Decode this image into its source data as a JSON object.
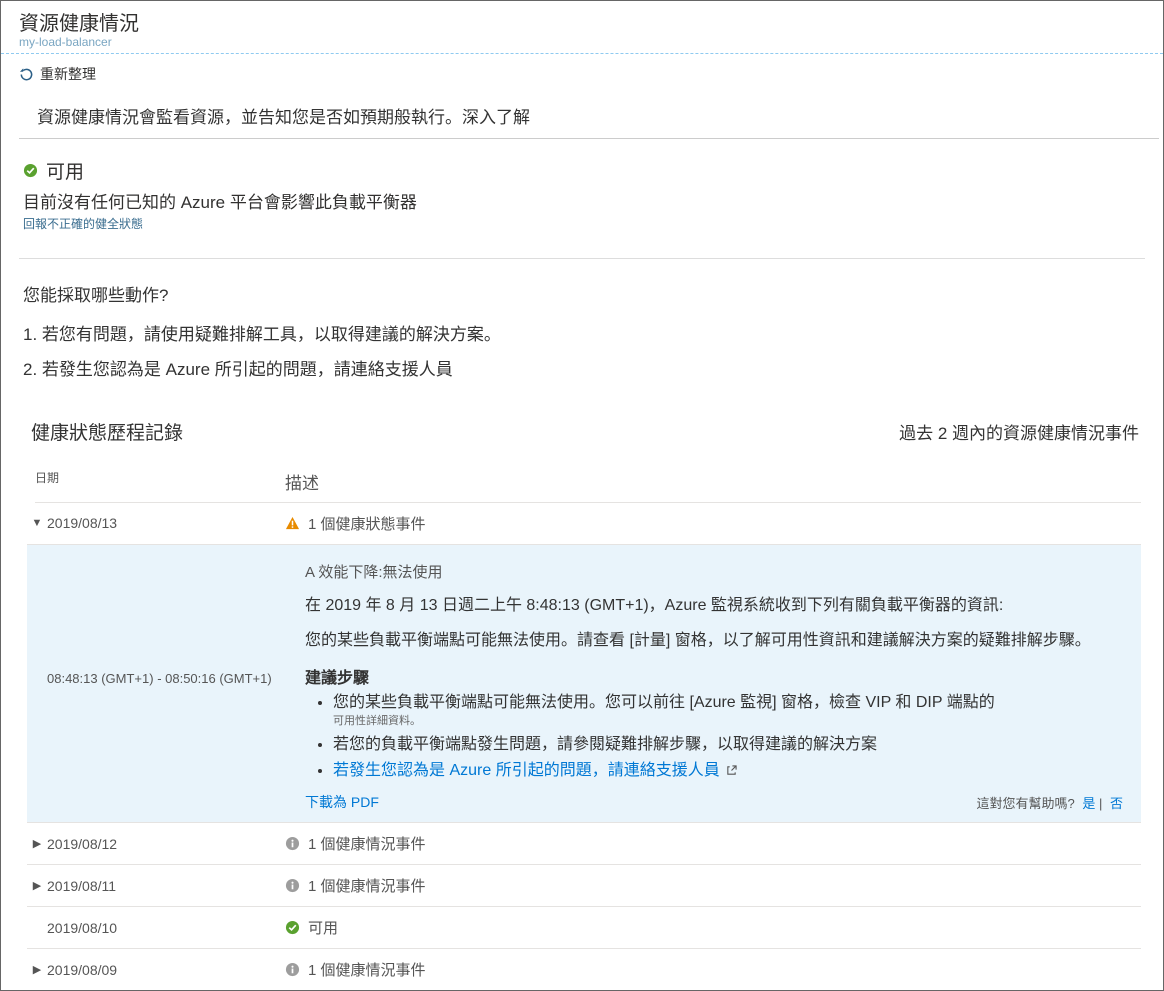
{
  "header": {
    "title": "資源健康情況",
    "subtitle": "my-load-balancer"
  },
  "toolbar": {
    "refresh": "重新整理"
  },
  "description": "資源健康情況會監看資源，並告知您是否如預期般執行。深入了解",
  "status": {
    "label": "可用",
    "sub": "目前沒有任何已知的 Azure 平台會影響此負載平衡器",
    "report_link": "回報不正確的健全狀態"
  },
  "actions": {
    "title": "您能採取哪些動作?",
    "items": [
      "1. 若您有問題，請使用疑難排解工具，以取得建議的解決方案。",
      "2. 若發生您認為是 Azure 所引起的問題，請連絡支援人員"
    ]
  },
  "history": {
    "title": "健康狀態歷程記錄",
    "range": "過去 2 週內的資源健康情況事件",
    "columns": {
      "date": "日期",
      "desc": "描述"
    },
    "rows": [
      {
        "expanded": true,
        "date": "2019/08/13",
        "icon": "warning",
        "desc": "1 個健康狀態事件"
      },
      {
        "expanded": false,
        "date": "2019/08/12",
        "icon": "info",
        "desc": "1 個健康情況事件"
      },
      {
        "expanded": false,
        "date": "2019/08/11",
        "icon": "info",
        "desc": "1 個健康情況事件"
      },
      {
        "expanded": null,
        "date": "2019/08/10",
        "icon": "check",
        "desc": "可用"
      },
      {
        "expanded": false,
        "date": "2019/08/09",
        "icon": "info",
        "desc": "1 個健康情況事件"
      }
    ]
  },
  "panel": {
    "time": "08:48:13 (GMT+1) - 08:50:16 (GMT+1)",
    "heading": "A 效能下降:無法使用",
    "p1": "在 2019 年 8 月 13 日週二上午 8:48:13 (GMT+1)，Azure 監視系統收到下列有關負載平衡器的資訊:",
    "p2": "您的某些負載平衡端點可能無法使用。請查看 [計量] 窗格，以了解可用性資訊和建議解決方案的疑難排解步驟。",
    "steps_title": "建議步驟",
    "steps": [
      {
        "text": "您的某些負載平衡端點可能無法使用。您可以前往 [Azure 監視] 窗格，檢查 VIP 和 DIP 端點的",
        "small": "可用性詳細資料。"
      },
      {
        "text": "若您的負載平衡端點發生問題，請參閱疑難排解步驟，以取得建議的解決方案"
      },
      {
        "link": "若發生您認為是 Azure 所引起的問題，請連絡支援人員",
        "external": true
      }
    ],
    "download": "下載為 PDF",
    "helpful_q": "這對您有幫助嗎?",
    "yes": "是",
    "no": "否"
  }
}
